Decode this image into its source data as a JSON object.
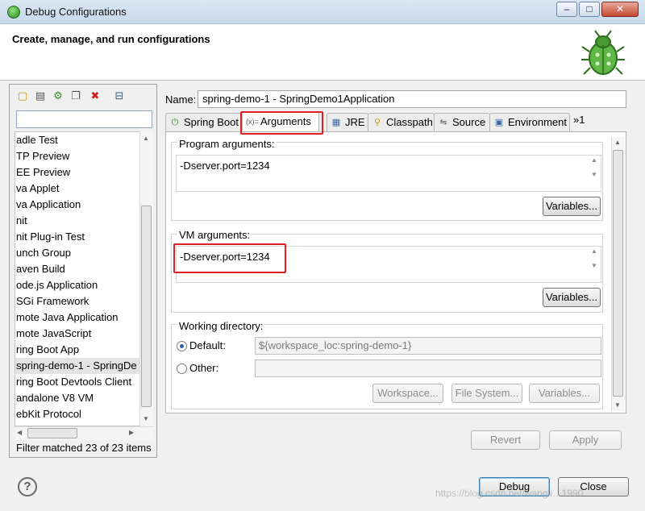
{
  "window": {
    "title": "Debug Configurations",
    "controls": {
      "minimize": "–",
      "maximize": "□",
      "close": "✕"
    }
  },
  "header": {
    "heading": "Create, manage, and run configurations"
  },
  "left_panel": {
    "toolbar": [
      "new-configuration-icon",
      "new-prototype-icon",
      "export-icon",
      "duplicate-icon",
      "delete-icon",
      "collapse-all-icon"
    ],
    "filter_placeholder": "",
    "items": [
      "adle Test",
      "TP Preview",
      "EE Preview",
      "va Applet",
      "va Application",
      "nit",
      "nit Plug-in Test",
      "unch Group",
      "aven Build",
      "ode.js Application",
      "SGi Framework",
      "mote Java Application",
      "mote JavaScript",
      "ring Boot App",
      "spring-demo-1 - SpringDe",
      "ring Boot Devtools Client",
      "andalone V8 VM",
      "ebKit Protocol"
    ],
    "selected_index": 14,
    "filter_status": "Filter matched 23 of 23 items"
  },
  "config": {
    "name_label": "Name:",
    "name_value": "spring-demo-1 - SpringDemo1Application",
    "tabs": [
      {
        "label": "Spring Boot",
        "icon": "spring-boot-icon"
      },
      {
        "label": "Arguments",
        "icon": "arguments-icon"
      },
      {
        "label": "JRE",
        "icon": "jre-icon"
      },
      {
        "label": "Classpath",
        "icon": "classpath-icon"
      },
      {
        "label": "Source",
        "icon": "source-icon"
      },
      {
        "label": "Environment",
        "icon": "environment-icon"
      }
    ],
    "more_tabs": "»1",
    "program_args_label": "Program arguments:",
    "program_args_value": "-Dserver.port=1234",
    "variables_label": "Variables...",
    "vm_args_label": "VM arguments:",
    "vm_args_value": "-Dserver.port=1234",
    "working_dir_label": "Working directory:",
    "default_label": "Default:",
    "default_value": "${workspace_loc:spring-demo-1}",
    "other_label": "Other:",
    "other_value": "",
    "workspace_btn": "Workspace...",
    "filesystem_btn": "File System...",
    "variables_btn": "Variables...",
    "revert_btn": "Revert",
    "apply_btn": "Apply"
  },
  "footer": {
    "debug_btn": "Debug",
    "close_btn": "Close",
    "help": "?",
    "watermark": "https://blog.csdn.net/wangli…1990"
  },
  "colors": {
    "highlight_box": "#e02020",
    "selection": "#e3e3e3",
    "title_bar": "#c6d8ec"
  }
}
